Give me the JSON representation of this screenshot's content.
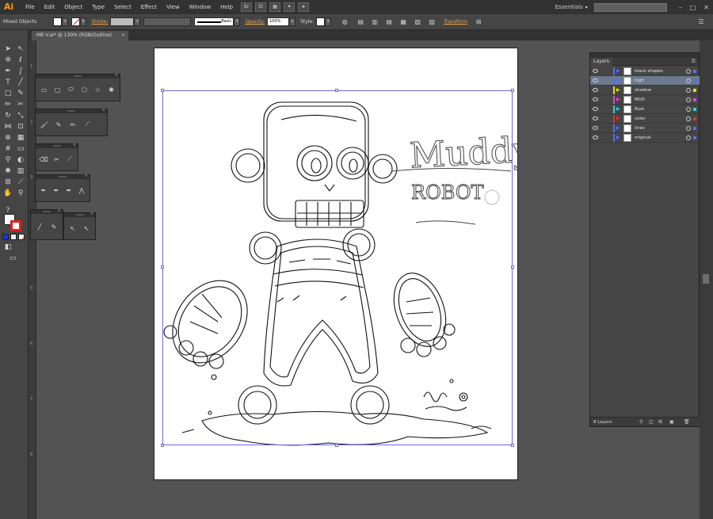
{
  "app": {
    "logo": "Ai"
  },
  "menubar": {
    "items": [
      "File",
      "Edit",
      "Object",
      "Type",
      "Select",
      "Effect",
      "View",
      "Window",
      "Help"
    ],
    "workspace_label": "Essentials"
  },
  "control_bar": {
    "selection_label": "Mixed Objects",
    "stroke_label": "Stroke:",
    "brush_label": "Basic",
    "opacity_label": "Opacity:",
    "opacity_value": "100%",
    "style_label": "Style:",
    "transform_label": "Transform"
  },
  "document": {
    "tab_title": "MR V.ai* @ 130% (RGB/Outline)",
    "close_label": "×"
  },
  "ruler": {
    "ticks": [
      "1",
      "2",
      "3",
      "4",
      "5",
      "6",
      "7",
      "8"
    ]
  },
  "artwork": {
    "title": "Muddy",
    "subtitle": "ROBOT"
  },
  "layers_panel": {
    "tab": "Layers",
    "count_label": "8 Layers",
    "layers": [
      {
        "name": "black shapes",
        "color": "#4f6fff",
        "selected": false
      },
      {
        "name": "high",
        "color": "#4f6fff",
        "selected": true
      },
      {
        "name": "shadow",
        "color": "#e0e000",
        "selected": false
      },
      {
        "name": "MUD",
        "color": "#e040e0",
        "selected": false
      },
      {
        "name": "Rust",
        "color": "#30d0e0",
        "selected": false
      },
      {
        "name": "color",
        "color": "#e03030",
        "selected": false
      },
      {
        "name": "lines",
        "color": "#4f6fff",
        "selected": false
      },
      {
        "name": "original",
        "color": "#4f6fff",
        "selected": false
      }
    ]
  },
  "icons": [
    "ai-logo-icon",
    "selection-tool-icon",
    "direct-selection-icon",
    "pen-tool-icon",
    "type-tool-icon",
    "rectangle-tool-icon",
    "brush-tool-icon",
    "eye-icon",
    "target-icon",
    "new-layer-icon",
    "trash-icon"
  ]
}
